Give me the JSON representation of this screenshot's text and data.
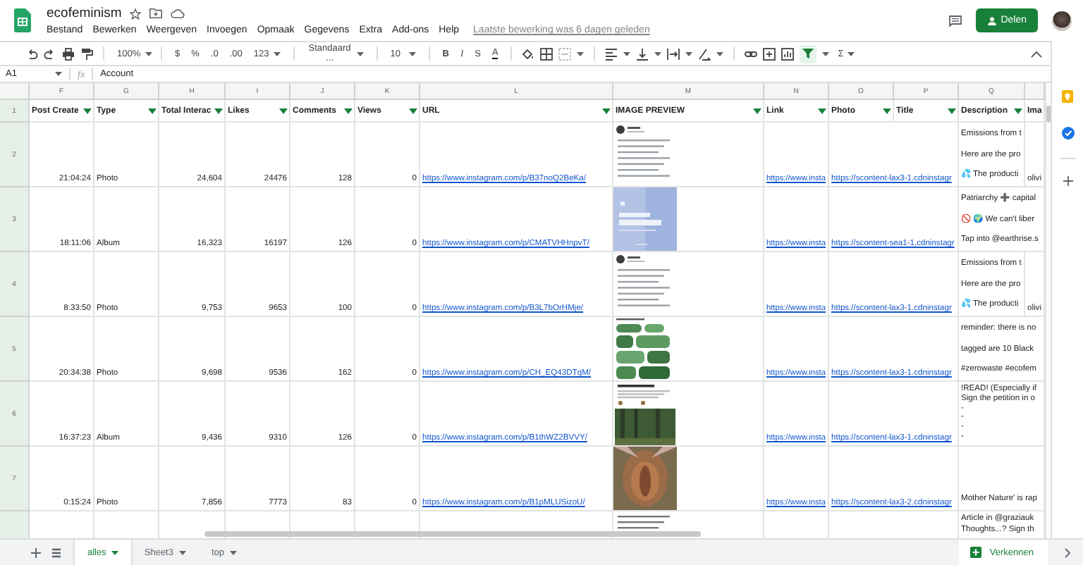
{
  "document": {
    "title": "ecofeminism",
    "starred": false,
    "last_edit": "Laatste bewerking was 6 dagen geleden"
  },
  "menu": [
    "Bestand",
    "Bewerken",
    "Weergeven",
    "Invoegen",
    "Opmaak",
    "Gegevens",
    "Extra",
    "Add-ons",
    "Help"
  ],
  "share_button": "Delen",
  "toolbar": {
    "zoom": "100%",
    "currency": "$",
    "percent": "%",
    "decimal_less": ".0",
    "decimal_more": ".00",
    "number_format": "123",
    "font": "Standaard ...",
    "font_size": "10",
    "bold": "B",
    "italic": "I",
    "strikethrough": "S",
    "text_color": "A",
    "functions": "Σ",
    "filter_on": true
  },
  "formula_bar": {
    "cell_ref": "A1",
    "fx": "fx",
    "value": "Account"
  },
  "header_row_number": "1",
  "columns": [
    {
      "letter": "F",
      "header": "Post Create",
      "filter": true
    },
    {
      "letter": "G",
      "header": "Type",
      "filter": true
    },
    {
      "letter": "H",
      "header": "Total Interac",
      "filter": true
    },
    {
      "letter": "I",
      "header": "Likes",
      "filter": true
    },
    {
      "letter": "J",
      "header": "Comments",
      "filter": true
    },
    {
      "letter": "K",
      "header": "Views",
      "filter": true
    },
    {
      "letter": "L",
      "header": "URL",
      "filter": true
    },
    {
      "letter": "M",
      "header": "IMAGE PREVIEW",
      "filter": true
    },
    {
      "letter": "N",
      "header": "Link",
      "filter": true
    },
    {
      "letter": "O",
      "header": "Photo",
      "filter": true
    },
    {
      "letter": "P",
      "header": "Title",
      "filter": true
    },
    {
      "letter": "Q",
      "header": "Description",
      "filter": true
    },
    {
      "header": "Ima"
    }
  ],
  "rows": [
    {
      "number": "2",
      "post_created": "21:04:24",
      "type": "Photo",
      "total_interactions": "24,604",
      "likes": "24476",
      "comments": "128",
      "views": "0",
      "url": "https://www.instagram.com/p/B37noQ2BeKa/",
      "image_preview": {
        "kind": "picture"
      },
      "link": "https://www.insta",
      "photo": "https://scontent-lax3-1.cdninstagr",
      "description": [
        "Emissions from t",
        "Here are the pro",
        "💦 The producti"
      ],
      "column_r": "olivi"
    },
    {
      "number": "3",
      "post_created": "18:11:06",
      "type": "Album",
      "total_interactions": "16,323",
      "likes": "16197",
      "comments": "126",
      "views": "0",
      "url": "https://www.instagram.com/p/CMATVHHnpvT/",
      "image_preview": {
        "kind": "picture"
      },
      "link": "https://www.insta",
      "photo": "https://scontent-sea1-1.cdninstagr",
      "description": [
        "Patriarchy ➕ capital",
        "🚫 🌍 We can't liber",
        "Tap into @earthrise.s"
      ]
    },
    {
      "number": "4",
      "post_created": "8:33:50",
      "type": "Photo",
      "total_interactions": "9,753",
      "likes": "9653",
      "comments": "100",
      "views": "0",
      "url": "https://www.instagram.com/p/B3L7bOrHMje/",
      "image_preview": {
        "kind": "picture"
      },
      "link": "https://www.insta",
      "photo": "https://scontent-lax3-1.cdninstagr",
      "description": [
        "Emissions from t",
        "Here are the pro",
        "💦 The producti"
      ],
      "column_r": "olivi"
    },
    {
      "number": "5",
      "post_created": "20:34:38",
      "type": "Photo",
      "total_interactions": "9,698",
      "likes": "9536",
      "comments": "162",
      "views": "0",
      "url": "https://www.instagram.com/p/CH_EQ43DTqM/",
      "image_preview": {
        "kind": "picture"
      },
      "link": "https://www.insta",
      "photo": "https://scontent-lax3-1.cdninstagr",
      "description": [
        "reminder: there is no",
        "tagged are 10 Black",
        "#zerowaste #ecofem"
      ]
    },
    {
      "number": "6",
      "post_created": "16:37:23",
      "type": "Album",
      "total_interactions": "9,436",
      "likes": "9310",
      "comments": "126",
      "views": "0",
      "url": "https://www.instagram.com/p/B1thWZ2BVVY/",
      "image_preview": {
        "kind": "picture"
      },
      "link": "https://www.insta",
      "photo": "https://scontent-lax3-1.cdninstagr",
      "description": [
        "!READ! (Especially if",
        "Sign the petition in o",
        "-",
        "-",
        "-",
        "-"
      ]
    },
    {
      "number": "7",
      "post_created": "0:15:24",
      "type": "Photo",
      "total_interactions": "7,856",
      "likes": "7773",
      "comments": "83",
      "views": "0",
      "url": "https://www.instagram.com/p/B1pMLUSizoU/",
      "image_preview": {
        "kind": "picture"
      },
      "link": "https://www.insta",
      "photo": "https://scontent-lax3-2.cdninstagr",
      "description": [
        "Mother Nature' is rap"
      ]
    },
    {
      "image_preview": {
        "kind": "picture"
      },
      "description": [
        "Article in @graziauk",
        "Thoughts...? Sign th"
      ]
    }
  ],
  "sheet_tabs": [
    {
      "label": "alles",
      "selected": true
    },
    {
      "label": "Sheet3",
      "selected": false
    },
    {
      "label": "top",
      "selected": false
    }
  ],
  "explore_button": "Verkennen"
}
